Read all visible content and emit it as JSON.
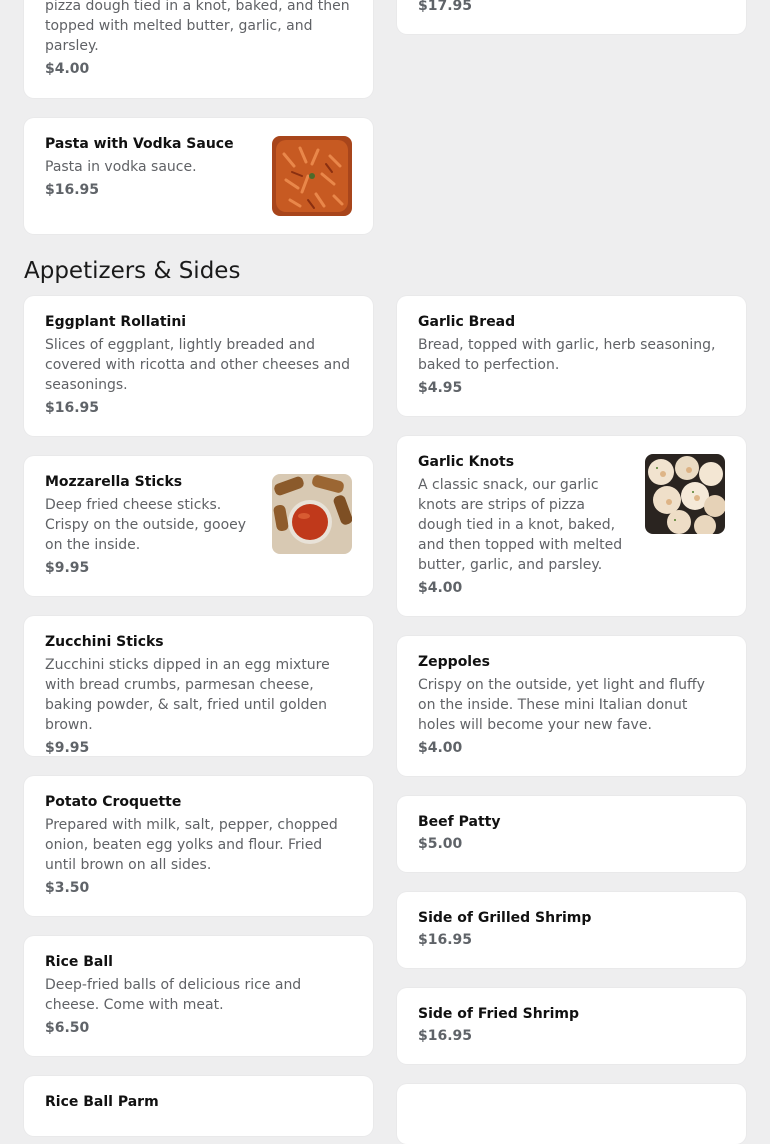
{
  "top": {
    "partial_desc": "pizza dough tied in a knot, baked, and then topped with melted butter, garlic, and parsley.",
    "partial_price_left": "$4.00",
    "partial_price_right": "$17.95"
  },
  "pasta_vodka": {
    "name": "Pasta with Vodka Sauce",
    "desc": "Pasta in vodka sauce.",
    "price": "$16.95"
  },
  "section": {
    "title": "Appetizers & Sides"
  },
  "items": {
    "eggplant": {
      "name": "Eggplant Rollatini",
      "desc": "Slices of eggplant, lightly breaded and covered with ricotta and other cheeses and seasonings.",
      "price": "$16.95"
    },
    "garlic_bread": {
      "name": "Garlic Bread",
      "desc": "Bread, topped with garlic, herb seasoning, baked to perfection.",
      "price": "$4.95"
    },
    "mozzarella": {
      "name": "Mozzarella Sticks",
      "desc": "Deep fried cheese sticks. Crispy on the outside, gooey on the inside.",
      "price": "$9.95"
    },
    "garlic_knots": {
      "name": "Garlic Knots",
      "desc": "A classic snack, our garlic knots are strips of pizza dough tied in a knot, baked, and then topped with melted butter, garlic, and parsley.",
      "price": "$4.00"
    },
    "zucchini": {
      "name": "Zucchini Sticks",
      "desc": "Zucchini sticks dipped in an egg mixture with bread crumbs, parmesan cheese, baking powder, & salt, fried until golden brown.",
      "price": "$9.95"
    },
    "zeppoles": {
      "name": "Zeppoles",
      "desc": "Crispy on the outside, yet light and fluffy on the inside. These mini Italian donut holes will become your new fave.",
      "price": "$4.00"
    },
    "croquette": {
      "name": "Potato Croquette",
      "desc": "Prepared with milk, salt, pepper, chopped onion, beaten egg yolks and flour. Fried until brown on all sides.",
      "price": "$3.50"
    },
    "beef_patty": {
      "name": "Beef Patty",
      "price": "$5.00"
    },
    "grilled_shrimp": {
      "name": "Side of Grilled Shrimp",
      "price": "$16.95"
    },
    "rice_ball": {
      "name": "Rice Ball",
      "desc": "Deep-fried balls of delicious rice and cheese. Come with meat.",
      "price": "$6.50"
    },
    "fried_shrimp": {
      "name": "Side of Fried Shrimp",
      "price": "$16.95"
    },
    "rice_ball_parm": {
      "name": "Rice Ball Parm"
    }
  }
}
